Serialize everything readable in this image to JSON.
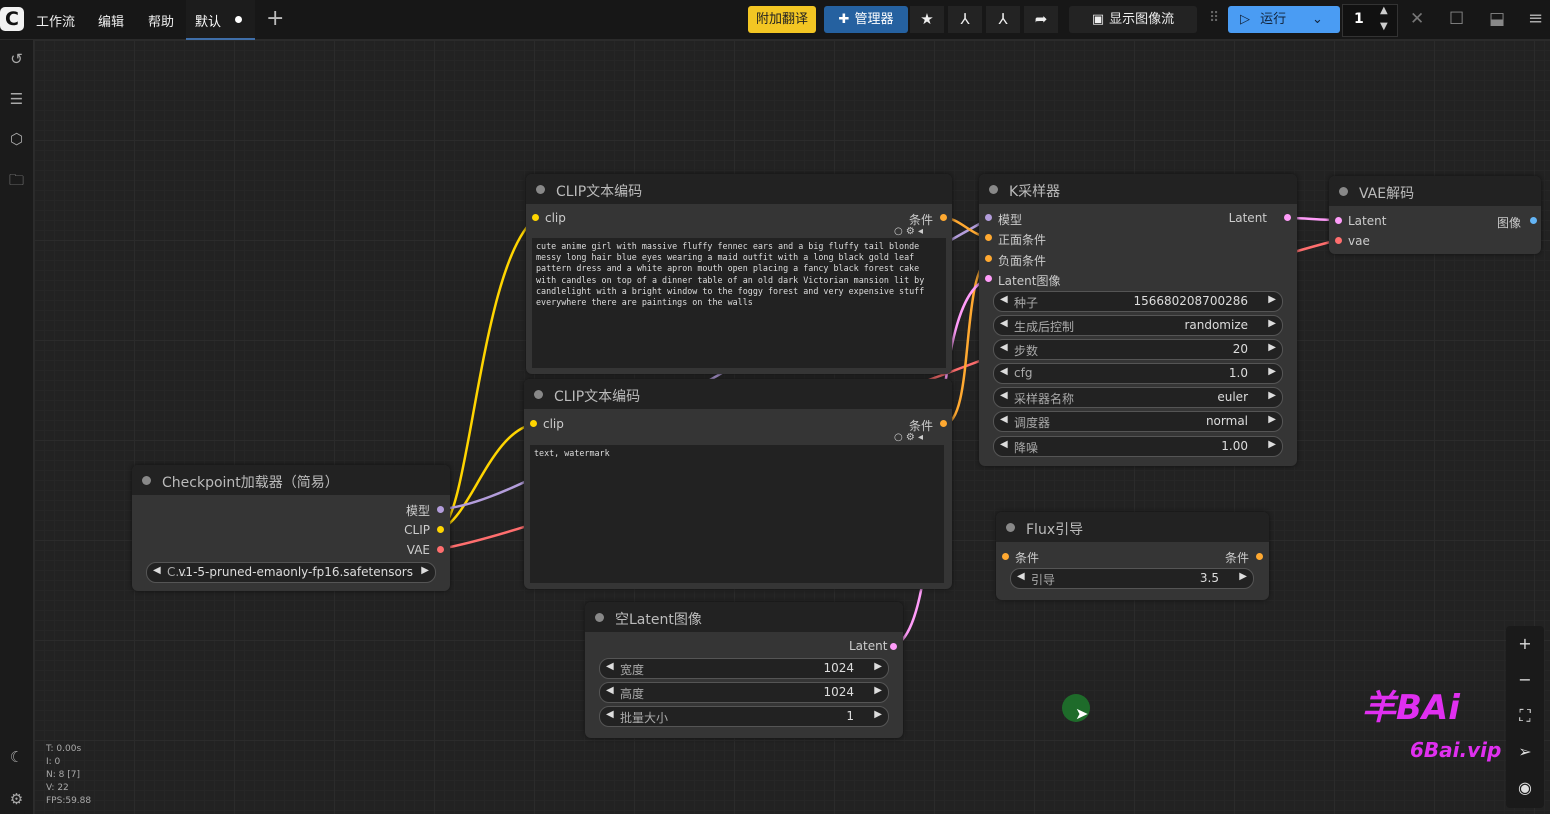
{
  "topbar": {
    "logo": "C",
    "menu": [
      "工作流",
      "编辑",
      "帮助"
    ],
    "tab_label": "默认",
    "translate_btn": "附加翻译",
    "manager_btn": "管理器",
    "show_image_stream": "显示图像流",
    "run_label": "运行",
    "queue_count": "1"
  },
  "stats": {
    "t": "T: 0.00s",
    "i": "I: 0",
    "n": "N: 8 [7]",
    "v": "V: 22",
    "fps": "FPS:59.88"
  },
  "nodes": {
    "clip1": {
      "title": "CLIP文本编码",
      "in": "clip",
      "out": "条件",
      "text": "cute anime girl with massive fluffy fennec ears and a big fluffy tail blonde messy long hair blue eyes wearing a maid outfit with a long black gold leaf pattern dress and a white apron mouth open placing a fancy black forest cake with candles on top of a dinner table of an old dark Victorian mansion lit by candlelight with a bright window to the foggy forest and very expensive stuff everywhere there are paintings on the walls"
    },
    "clip2": {
      "title": "CLIP文本编码",
      "in": "clip",
      "out": "条件",
      "text": "text, watermark"
    },
    "checkpoint": {
      "title": "Checkpoint加载器（简易）",
      "out_model": "模型",
      "out_clip": "CLIP",
      "out_vae": "VAE",
      "ckpt_prefix": "C...",
      "ckpt_name": "v1-5-pruned-emaonly-fp16.safetensors"
    },
    "ksampler": {
      "title": "K采样器",
      "in_model": "模型",
      "in_pos": "正面条件",
      "in_neg": "负面条件",
      "in_latent": "Latent图像",
      "out": "Latent",
      "widgets": [
        {
          "label": "种子",
          "value": "156680208700286"
        },
        {
          "label": "生成后控制",
          "value": "randomize"
        },
        {
          "label": "步数",
          "value": "20"
        },
        {
          "label": "cfg",
          "value": "1.0"
        },
        {
          "label": "采样器名称",
          "value": "euler"
        },
        {
          "label": "调度器",
          "value": "normal"
        },
        {
          "label": "降噪",
          "value": "1.00"
        }
      ]
    },
    "vae": {
      "title": "VAE解码",
      "in_latent": "Latent",
      "in_vae": "vae",
      "out": "图像"
    },
    "flux": {
      "title": "Flux引导",
      "in": "条件",
      "out": "条件",
      "widget_label": "引导",
      "widget_value": "3.5"
    },
    "latent": {
      "title": "空Latent图像",
      "out": "Latent",
      "widgets": [
        {
          "label": "宽度",
          "value": "1024"
        },
        {
          "label": "高度",
          "value": "1024"
        },
        {
          "label": "批量大小",
          "value": "1"
        }
      ]
    }
  },
  "watermark": {
    "brand": "羊BAi",
    "site": "6Bai.vip"
  },
  "colors": {
    "clip": "#ffd500",
    "model": "#b39ddb",
    "vae": "#ff6e6e",
    "cond": "#ffa931",
    "latent": "#ff9cf9",
    "image": "#64b5f6",
    "run": "#3b82f6"
  }
}
